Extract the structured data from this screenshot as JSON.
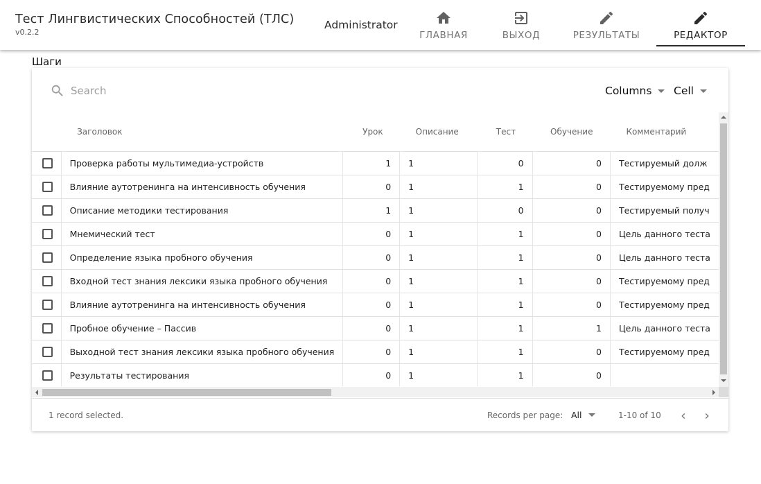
{
  "header": {
    "app_title": "Тест Лингвистических Способностей (ТЛС)",
    "version": "v0.2.2",
    "user": "Administrator",
    "nav": [
      {
        "label": "ГЛАВНАЯ",
        "icon": "home-icon"
      },
      {
        "label": "ВЫХОД",
        "icon": "logout-icon"
      },
      {
        "label": "РЕЗУЛЬТАТЫ",
        "icon": "pencil-icon"
      },
      {
        "label": "РЕДАКТОР",
        "icon": "pencil-icon",
        "active": true
      }
    ]
  },
  "section": {
    "title": "Шаги"
  },
  "toolbar": {
    "search_placeholder": "Search",
    "columns_label": "Columns",
    "cell_label": "Cell"
  },
  "table": {
    "columns": [
      "Заголовок",
      "Урок",
      "Описание",
      "Тест",
      "Обучение",
      "Комментарий"
    ],
    "rows": [
      {
        "title": "Проверка работы мультимедиа-устройств",
        "lesson": "1",
        "description": "1",
        "test": "0",
        "training": "0",
        "comment": "Тестируемый долж"
      },
      {
        "title": "Влияние аутотренинга на интенсивность обучения",
        "lesson": "0",
        "description": "1",
        "test": "1",
        "training": "0",
        "comment": "Тестируемому пред"
      },
      {
        "title": "Описание методики тестирования",
        "lesson": "1",
        "description": "1",
        "test": "0",
        "training": "0",
        "comment": "Тестируемый получ"
      },
      {
        "title": "Мнемический тест",
        "lesson": "0",
        "description": "1",
        "test": "1",
        "training": "0",
        "comment": "Цель данного теста"
      },
      {
        "title": "Определение языка пробного обучения",
        "lesson": "0",
        "description": "1",
        "test": "1",
        "training": "0",
        "comment": "Цель данного теста"
      },
      {
        "title": "Входной тест знания лексики языка пробного обучения",
        "lesson": "0",
        "description": "1",
        "test": "1",
        "training": "0",
        "comment": "Тестируемому пред"
      },
      {
        "title": "Влияние аутотренинга на интенсивность обучения",
        "lesson": "0",
        "description": "1",
        "test": "1",
        "training": "0",
        "comment": "Тестируемому пред"
      },
      {
        "title": "Пробное обучение – Пассив",
        "lesson": "0",
        "description": "1",
        "test": "1",
        "training": "1",
        "comment": "Цель данного теста"
      },
      {
        "title": "Выходной тест знания лексики языка пробного обучения",
        "lesson": "0",
        "description": "1",
        "test": "1",
        "training": "0",
        "comment": "Тестируемому пред"
      },
      {
        "title": "Результаты тестирования",
        "lesson": "0",
        "description": "1",
        "test": "1",
        "training": "0",
        "comment": ""
      }
    ]
  },
  "footer": {
    "selection_text": "1 record selected.",
    "rpp_label": "Records per page:",
    "rpp_value": "All",
    "range_text": "1-10 of 10"
  },
  "colors": {
    "accent": "#2b2b2b",
    "icon": "#616161",
    "muted": "#757575"
  }
}
